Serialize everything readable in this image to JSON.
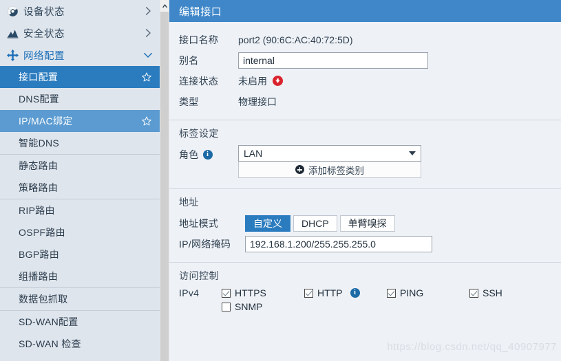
{
  "sidebar": {
    "groups": [
      {
        "icon": "dashboard-icon",
        "label": "设备状态",
        "chevron": "chevron-right-icon",
        "active": false
      },
      {
        "icon": "chart-mountain-icon",
        "label": "安全状态",
        "chevron": "chevron-right-icon",
        "active": false
      },
      {
        "icon": "move-arrows-icon",
        "label": "网络配置",
        "chevron": "chevron-down-icon",
        "active": true
      }
    ],
    "items": [
      {
        "label": "接口配置",
        "state": "selected",
        "star": true,
        "divider_before": false
      },
      {
        "label": "DNS配置",
        "state": "normal",
        "star": false,
        "divider_before": false
      },
      {
        "label": "IP/MAC绑定",
        "state": "hovered",
        "star": true,
        "divider_before": false
      },
      {
        "label": "智能DNS",
        "state": "normal",
        "star": false,
        "divider_before": false
      },
      {
        "label": "静态路由",
        "state": "normal",
        "star": false,
        "divider_before": true
      },
      {
        "label": "策略路由",
        "state": "normal",
        "star": false,
        "divider_before": false
      },
      {
        "label": "RIP路由",
        "state": "normal",
        "star": false,
        "divider_before": true
      },
      {
        "label": "OSPF路由",
        "state": "normal",
        "star": false,
        "divider_before": false
      },
      {
        "label": "BGP路由",
        "state": "normal",
        "star": false,
        "divider_before": false
      },
      {
        "label": "组播路由",
        "state": "normal",
        "star": false,
        "divider_before": false
      },
      {
        "label": "数据包抓取",
        "state": "normal",
        "star": false,
        "divider_before": true
      },
      {
        "label": "SD-WAN配置",
        "state": "normal",
        "star": false,
        "divider_before": true
      },
      {
        "label": "SD-WAN 检查",
        "state": "normal",
        "star": false,
        "divider_before": false
      }
    ]
  },
  "scrollbar": {
    "up_arrow": "chevron-up-icon"
  },
  "panel": {
    "title": "编辑接口",
    "interface_name_label": "接口名称",
    "interface_name_value": "port2 (90:6C:AC:40:72:5D)",
    "alias_label": "别名",
    "alias_value": "internal",
    "link_status_label": "连接状态",
    "link_status_value": "未启用",
    "link_status_icon": "arrow-down-circle-red-icon",
    "type_label": "类型",
    "type_value": "物理接口"
  },
  "tag_section": {
    "heading": "标签设定",
    "role_label": "角色",
    "role_info_icon": "info-icon",
    "role_value": "LAN",
    "role_caret": "chevron-down-icon",
    "add_button_label": "添加标签类别",
    "add_button_icon": "plus-circle-icon"
  },
  "address_section": {
    "heading": "地址",
    "mode_label": "地址模式",
    "modes": [
      {
        "label": "自定义",
        "active": true
      },
      {
        "label": "DHCP",
        "active": false
      },
      {
        "label": "单臂嗅探",
        "active": false
      }
    ],
    "ipmask_label": "IP/网络掩码",
    "ipmask_value": "192.168.1.200/255.255.255.0"
  },
  "access_section": {
    "heading": "访问控制",
    "ipv4_label": "IPv4",
    "row1": [
      {
        "label": "HTTPS",
        "checked": true,
        "info": false
      },
      {
        "label": "HTTP",
        "checked": true,
        "info": true
      },
      {
        "label": "PING",
        "checked": true,
        "info": false
      },
      {
        "label": "SSH",
        "checked": true,
        "info": false
      }
    ],
    "row2": [
      {
        "label": "SNMP",
        "checked": false,
        "info": false
      }
    ]
  },
  "watermark": {
    "text": "https://blog.csdn.net/qq_40907977"
  },
  "colors": {
    "accent_blue": "#2b7cbf",
    "title_blue": "#3f87c9",
    "hover_blue": "#5b9bd1",
    "sidebar_bg": "#dfe5ec",
    "content_bg": "#eef1f6",
    "status_red": "#d9232d",
    "info_blue": "#1b6aa5"
  }
}
